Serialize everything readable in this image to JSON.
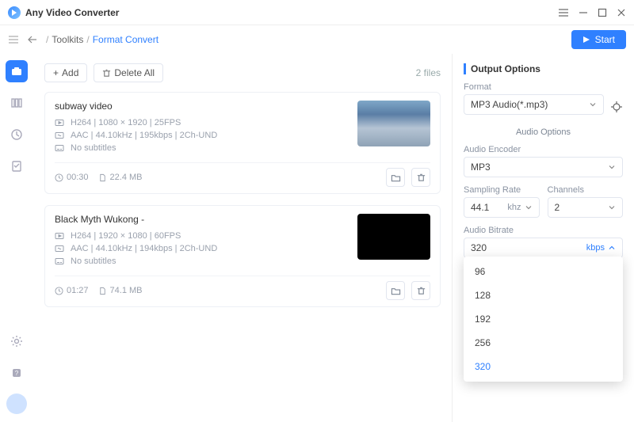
{
  "app": {
    "title": "Any Video Converter"
  },
  "toolbar": {
    "breadcrumb": {
      "root": "Toolkits",
      "current": "Format Convert"
    },
    "start": "Start"
  },
  "filelist": {
    "add": "Add",
    "delete_all": "Delete All",
    "count": "2 files"
  },
  "files": [
    {
      "title": "subway video",
      "video": "H264 | 1080 × 1920 | 25FPS",
      "audio": "AAC | 44.10kHz | 195kbps | 2Ch-UND",
      "subs": "No subtitles",
      "duration": "00:30",
      "size": "22.4 MB",
      "thumb": "subway"
    },
    {
      "title": "Black Myth Wukong -",
      "video": "H264 | 1920 × 1080 | 60FPS",
      "audio": "AAC | 44.10kHz | 194kbps | 2Ch-UND",
      "subs": "No subtitles",
      "duration": "01:27",
      "size": "74.1 MB",
      "thumb": "black"
    }
  ],
  "output": {
    "title": "Output Options",
    "format_label": "Format",
    "format_value": "MP3 Audio(*.mp3)",
    "audio_section": "Audio Options",
    "encoder_label": "Audio Encoder",
    "encoder_value": "MP3",
    "sampling_label": "Sampling Rate",
    "sampling_value": "44.1",
    "sampling_unit": "khz",
    "channels_label": "Channels",
    "channels_value": "2",
    "bitrate_label": "Audio Bitrate",
    "bitrate_value": "320",
    "bitrate_unit": "kbps",
    "bitrate_options": [
      "96",
      "128",
      "192",
      "256",
      "320"
    ]
  }
}
